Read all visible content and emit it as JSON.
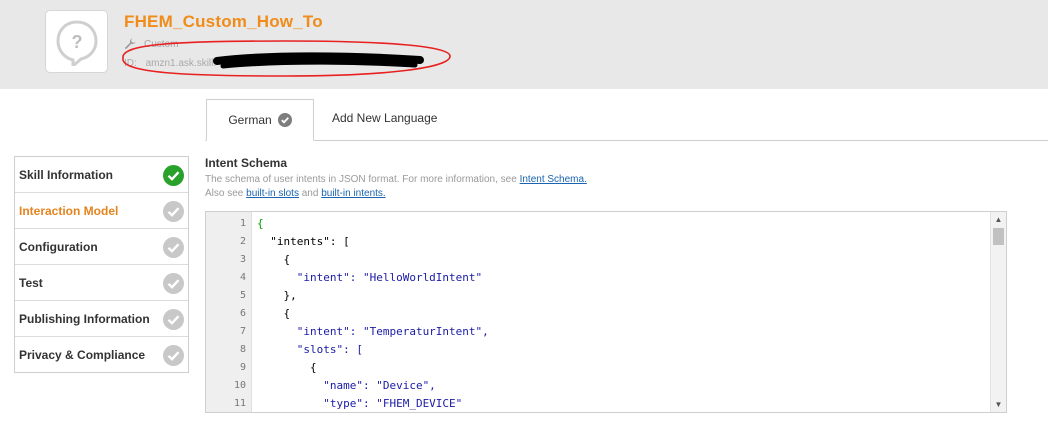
{
  "header": {
    "title": "FHEM_Custom_How_To",
    "type_label": "Custom",
    "id_label": "ID:",
    "id_value": "amzn1.ask.skill."
  },
  "tabs": [
    {
      "label": "German",
      "selected": true
    },
    {
      "label": "Add New Language",
      "selected": false
    }
  ],
  "sidebar": {
    "items": [
      {
        "label": "Skill Information",
        "status": "complete",
        "active": false
      },
      {
        "label": "Interaction Model",
        "status": "pending",
        "active": true
      },
      {
        "label": "Configuration",
        "status": "pending",
        "active": false
      },
      {
        "label": "Test",
        "status": "pending",
        "active": false
      },
      {
        "label": "Publishing Information",
        "status": "pending",
        "active": false
      },
      {
        "label": "Privacy & Compliance",
        "status": "pending",
        "active": false
      }
    ]
  },
  "intent_schema": {
    "title": "Intent Schema",
    "desc_1": "The schema of user intents in JSON format. For more information, see ",
    "desc_link_1": "Intent Schema.",
    "desc_2": "Also see ",
    "desc_link_2": "built-in slots",
    "desc_3": " and ",
    "desc_link_3": "built-in intents."
  },
  "editor": {
    "line_numbers": [
      "1",
      "2",
      "3",
      "4",
      "5",
      "6",
      "7",
      "8",
      "9",
      "10",
      "11"
    ],
    "lines": [
      "{",
      "  \"intents\": [",
      "    {",
      "      \"intent\": \"HelloWorldIntent\"",
      "    },",
      "    {",
      "      \"intent\": \"TemperaturIntent\",",
      "      \"slots\": [",
      "        {",
      "          \"name\": \"Device\",",
      "          \"type\": \"FHEM_DEVICE\""
    ]
  },
  "colors": {
    "accent": "#f08c1a",
    "success": "#2aa12a",
    "pending": "#c8c8c8",
    "link": "#1a64b0",
    "annotation": "#e82020"
  },
  "icons": {
    "skill": "speech-bubble-question-icon",
    "type": "wrench-icon",
    "complete": "check-circle-icon",
    "pending": "check-circle-gray-icon"
  }
}
